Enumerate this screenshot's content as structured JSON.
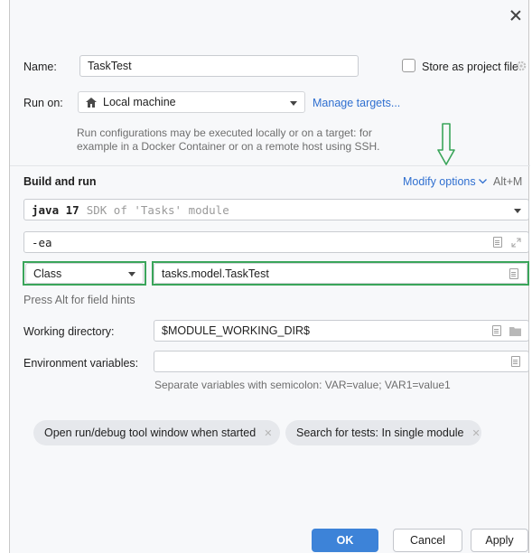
{
  "dialog": {
    "name_label": "Name:",
    "name_value": "TaskTest",
    "store_label": "Store as project file",
    "run_on_label": "Run on:",
    "run_on_value": "Local machine",
    "manage_targets": "Manage targets...",
    "run_hint_line1": "Run configurations may be executed locally or on a target: for",
    "run_hint_line2": "example in a Docker Container or on a remote host using SSH.",
    "build_and_run": "Build and run",
    "modify_options": "Modify options",
    "modify_shortcut": "Alt+M",
    "sdk_version": "java 17",
    "sdk_detail": "SDK of 'Tasks' module",
    "vm_options": "-ea",
    "class_kind": "Class",
    "class_value": "tasks.model.TaskTest",
    "field_hints": "Press Alt for field hints",
    "working_dir_label": "Working directory:",
    "working_dir_value": "$MODULE_WORKING_DIR$",
    "env_label": "Environment variables:",
    "env_hint": "Separate variables with semicolon: VAR=value; VAR1=value1",
    "chips": [
      "Open run/debug tool window when started",
      "Search for tests: In single module"
    ],
    "ok": "OK",
    "cancel": "Cancel",
    "apply": "Apply"
  },
  "colors": {
    "accent": "#3d83d8",
    "link": "#2f6fd0",
    "highlight": "#3aa55a"
  },
  "icons": [
    "close-icon",
    "home-icon",
    "gear-icon",
    "chevron-down-icon",
    "document-icon",
    "expand-icon",
    "folder-icon",
    "down-arrow-annotation-icon"
  ]
}
